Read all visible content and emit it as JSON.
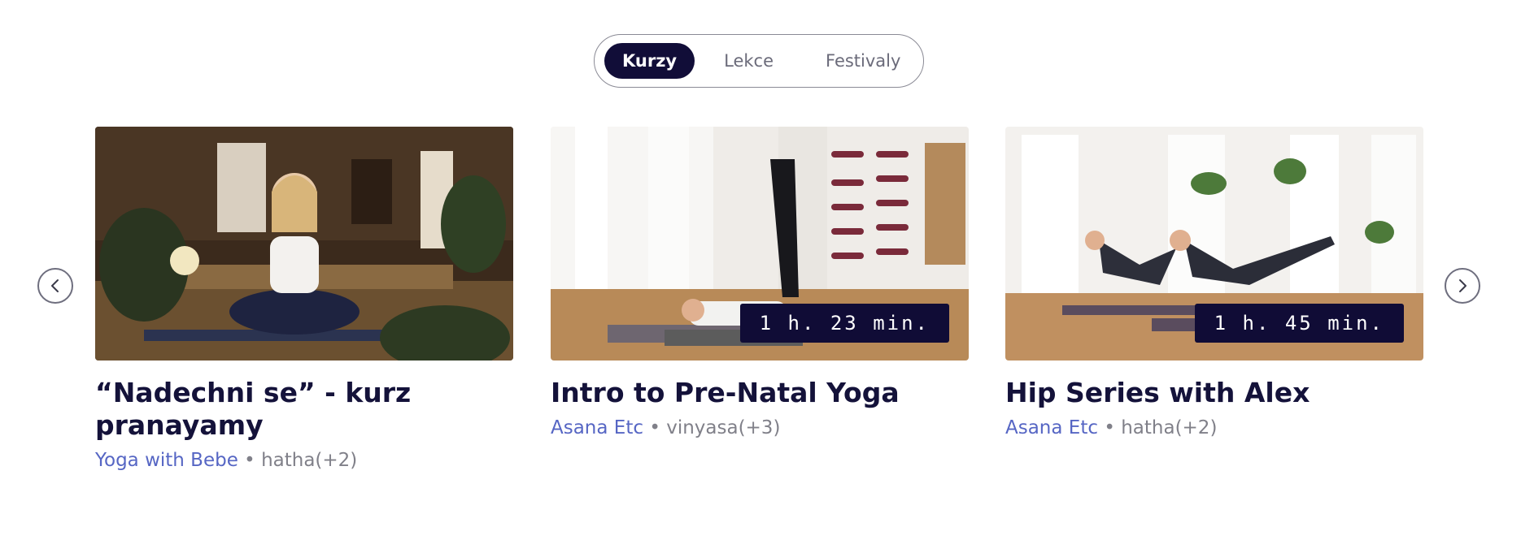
{
  "tabs": [
    {
      "label": "Kurzy",
      "active": true
    },
    {
      "label": "Lekce",
      "active": false
    },
    {
      "label": "Festivaly",
      "active": false
    }
  ],
  "nav": {
    "prev_icon": "chevron-left-icon",
    "next_icon": "chevron-right-icon"
  },
  "cards": [
    {
      "title": "“Nadechni se” - kurz pranayamy",
      "author": "Yoga with Bebe",
      "separator": "•",
      "tags": "hatha(+2)",
      "duration": ""
    },
    {
      "title": "Intro to Pre-Natal Yoga",
      "author": "Asana Etc",
      "separator": "•",
      "tags": "vinyasa(+3)",
      "duration": "1 h. 23 min."
    },
    {
      "title": "Hip Series with Alex",
      "author": "Asana Etc",
      "separator": "•",
      "tags": "hatha(+2)",
      "duration": "1 h. 45 min."
    }
  ],
  "colors": {
    "accent": "#110d38",
    "link": "#5666c4",
    "muted": "#808089"
  }
}
